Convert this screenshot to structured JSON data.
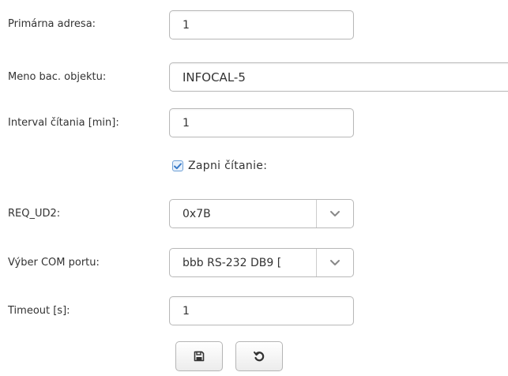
{
  "form": {
    "primary_address": {
      "label": "Primárna adresa:",
      "value": "1"
    },
    "object_name": {
      "label": "Meno bac. objektu:",
      "value": "INFOCAL-5"
    },
    "read_interval": {
      "label": "Interval čítania [min]:",
      "value": "1"
    },
    "enable_reading": {
      "label": "Zapni čítanie:",
      "checked": true
    },
    "req_ud2": {
      "label": "REQ_UD2:",
      "value": "0x7B"
    },
    "com_port": {
      "label": "Výber COM portu:",
      "value": "bbb RS-232 DB9 ["
    },
    "timeout": {
      "label": "Timeout [s]:",
      "value": "1"
    }
  },
  "buttons": {
    "save_icon": "floppy-disk-icon",
    "reset_icon": "undo-icon"
  },
  "colors": {
    "checkbox_accent": "#3a7bc8",
    "border": "#b8b8b8",
    "text": "#333333"
  }
}
